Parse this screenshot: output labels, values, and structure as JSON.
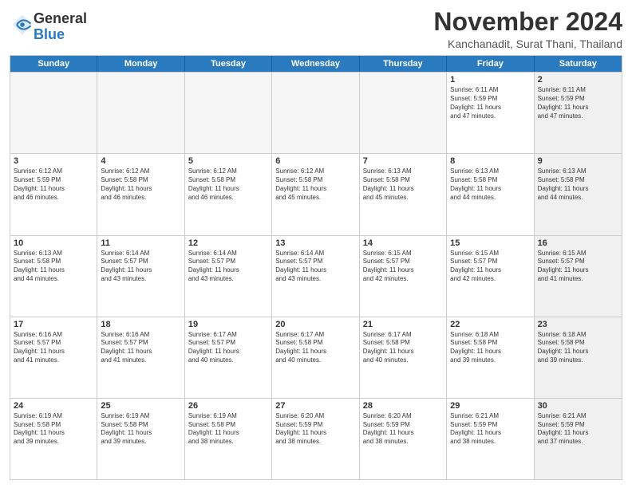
{
  "logo": {
    "general": "General",
    "blue": "Blue"
  },
  "title": "November 2024",
  "subtitle": "Kanchanadit, Surat Thani, Thailand",
  "days": [
    "Sunday",
    "Monday",
    "Tuesday",
    "Wednesday",
    "Thursday",
    "Friday",
    "Saturday"
  ],
  "rows": [
    [
      {
        "day": "",
        "info": "",
        "empty": true
      },
      {
        "day": "",
        "info": "",
        "empty": true
      },
      {
        "day": "",
        "info": "",
        "empty": true
      },
      {
        "day": "",
        "info": "",
        "empty": true
      },
      {
        "day": "",
        "info": "",
        "empty": true
      },
      {
        "day": "1",
        "info": "Sunrise: 6:11 AM\nSunset: 5:59 PM\nDaylight: 11 hours\nand 47 minutes.",
        "empty": false,
        "shaded": false
      },
      {
        "day": "2",
        "info": "Sunrise: 6:11 AM\nSunset: 5:59 PM\nDaylight: 11 hours\nand 47 minutes.",
        "empty": false,
        "shaded": true
      }
    ],
    [
      {
        "day": "3",
        "info": "Sunrise: 6:12 AM\nSunset: 5:59 PM\nDaylight: 11 hours\nand 46 minutes.",
        "empty": false,
        "shaded": false
      },
      {
        "day": "4",
        "info": "Sunrise: 6:12 AM\nSunset: 5:58 PM\nDaylight: 11 hours\nand 46 minutes.",
        "empty": false,
        "shaded": false
      },
      {
        "day": "5",
        "info": "Sunrise: 6:12 AM\nSunset: 5:58 PM\nDaylight: 11 hours\nand 46 minutes.",
        "empty": false,
        "shaded": false
      },
      {
        "day": "6",
        "info": "Sunrise: 6:12 AM\nSunset: 5:58 PM\nDaylight: 11 hours\nand 45 minutes.",
        "empty": false,
        "shaded": false
      },
      {
        "day": "7",
        "info": "Sunrise: 6:13 AM\nSunset: 5:58 PM\nDaylight: 11 hours\nand 45 minutes.",
        "empty": false,
        "shaded": false
      },
      {
        "day": "8",
        "info": "Sunrise: 6:13 AM\nSunset: 5:58 PM\nDaylight: 11 hours\nand 44 minutes.",
        "empty": false,
        "shaded": false
      },
      {
        "day": "9",
        "info": "Sunrise: 6:13 AM\nSunset: 5:58 PM\nDaylight: 11 hours\nand 44 minutes.",
        "empty": false,
        "shaded": true
      }
    ],
    [
      {
        "day": "10",
        "info": "Sunrise: 6:13 AM\nSunset: 5:58 PM\nDaylight: 11 hours\nand 44 minutes.",
        "empty": false,
        "shaded": false
      },
      {
        "day": "11",
        "info": "Sunrise: 6:14 AM\nSunset: 5:57 PM\nDaylight: 11 hours\nand 43 minutes.",
        "empty": false,
        "shaded": false
      },
      {
        "day": "12",
        "info": "Sunrise: 6:14 AM\nSunset: 5:57 PM\nDaylight: 11 hours\nand 43 minutes.",
        "empty": false,
        "shaded": false
      },
      {
        "day": "13",
        "info": "Sunrise: 6:14 AM\nSunset: 5:57 PM\nDaylight: 11 hours\nand 43 minutes.",
        "empty": false,
        "shaded": false
      },
      {
        "day": "14",
        "info": "Sunrise: 6:15 AM\nSunset: 5:57 PM\nDaylight: 11 hours\nand 42 minutes.",
        "empty": false,
        "shaded": false
      },
      {
        "day": "15",
        "info": "Sunrise: 6:15 AM\nSunset: 5:57 PM\nDaylight: 11 hours\nand 42 minutes.",
        "empty": false,
        "shaded": false
      },
      {
        "day": "16",
        "info": "Sunrise: 6:15 AM\nSunset: 5:57 PM\nDaylight: 11 hours\nand 41 minutes.",
        "empty": false,
        "shaded": true
      }
    ],
    [
      {
        "day": "17",
        "info": "Sunrise: 6:16 AM\nSunset: 5:57 PM\nDaylight: 11 hours\nand 41 minutes.",
        "empty": false,
        "shaded": false
      },
      {
        "day": "18",
        "info": "Sunrise: 6:16 AM\nSunset: 5:57 PM\nDaylight: 11 hours\nand 41 minutes.",
        "empty": false,
        "shaded": false
      },
      {
        "day": "19",
        "info": "Sunrise: 6:17 AM\nSunset: 5:57 PM\nDaylight: 11 hours\nand 40 minutes.",
        "empty": false,
        "shaded": false
      },
      {
        "day": "20",
        "info": "Sunrise: 6:17 AM\nSunset: 5:58 PM\nDaylight: 11 hours\nand 40 minutes.",
        "empty": false,
        "shaded": false
      },
      {
        "day": "21",
        "info": "Sunrise: 6:17 AM\nSunset: 5:58 PM\nDaylight: 11 hours\nand 40 minutes.",
        "empty": false,
        "shaded": false
      },
      {
        "day": "22",
        "info": "Sunrise: 6:18 AM\nSunset: 5:58 PM\nDaylight: 11 hours\nand 39 minutes.",
        "empty": false,
        "shaded": false
      },
      {
        "day": "23",
        "info": "Sunrise: 6:18 AM\nSunset: 5:58 PM\nDaylight: 11 hours\nand 39 minutes.",
        "empty": false,
        "shaded": true
      }
    ],
    [
      {
        "day": "24",
        "info": "Sunrise: 6:19 AM\nSunset: 5:58 PM\nDaylight: 11 hours\nand 39 minutes.",
        "empty": false,
        "shaded": false
      },
      {
        "day": "25",
        "info": "Sunrise: 6:19 AM\nSunset: 5:58 PM\nDaylight: 11 hours\nand 39 minutes.",
        "empty": false,
        "shaded": false
      },
      {
        "day": "26",
        "info": "Sunrise: 6:19 AM\nSunset: 5:58 PM\nDaylight: 11 hours\nand 38 minutes.",
        "empty": false,
        "shaded": false
      },
      {
        "day": "27",
        "info": "Sunrise: 6:20 AM\nSunset: 5:59 PM\nDaylight: 11 hours\nand 38 minutes.",
        "empty": false,
        "shaded": false
      },
      {
        "day": "28",
        "info": "Sunrise: 6:20 AM\nSunset: 5:59 PM\nDaylight: 11 hours\nand 38 minutes.",
        "empty": false,
        "shaded": false
      },
      {
        "day": "29",
        "info": "Sunrise: 6:21 AM\nSunset: 5:59 PM\nDaylight: 11 hours\nand 38 minutes.",
        "empty": false,
        "shaded": false
      },
      {
        "day": "30",
        "info": "Sunrise: 6:21 AM\nSunset: 5:59 PM\nDaylight: 11 hours\nand 37 minutes.",
        "empty": false,
        "shaded": true
      }
    ]
  ]
}
